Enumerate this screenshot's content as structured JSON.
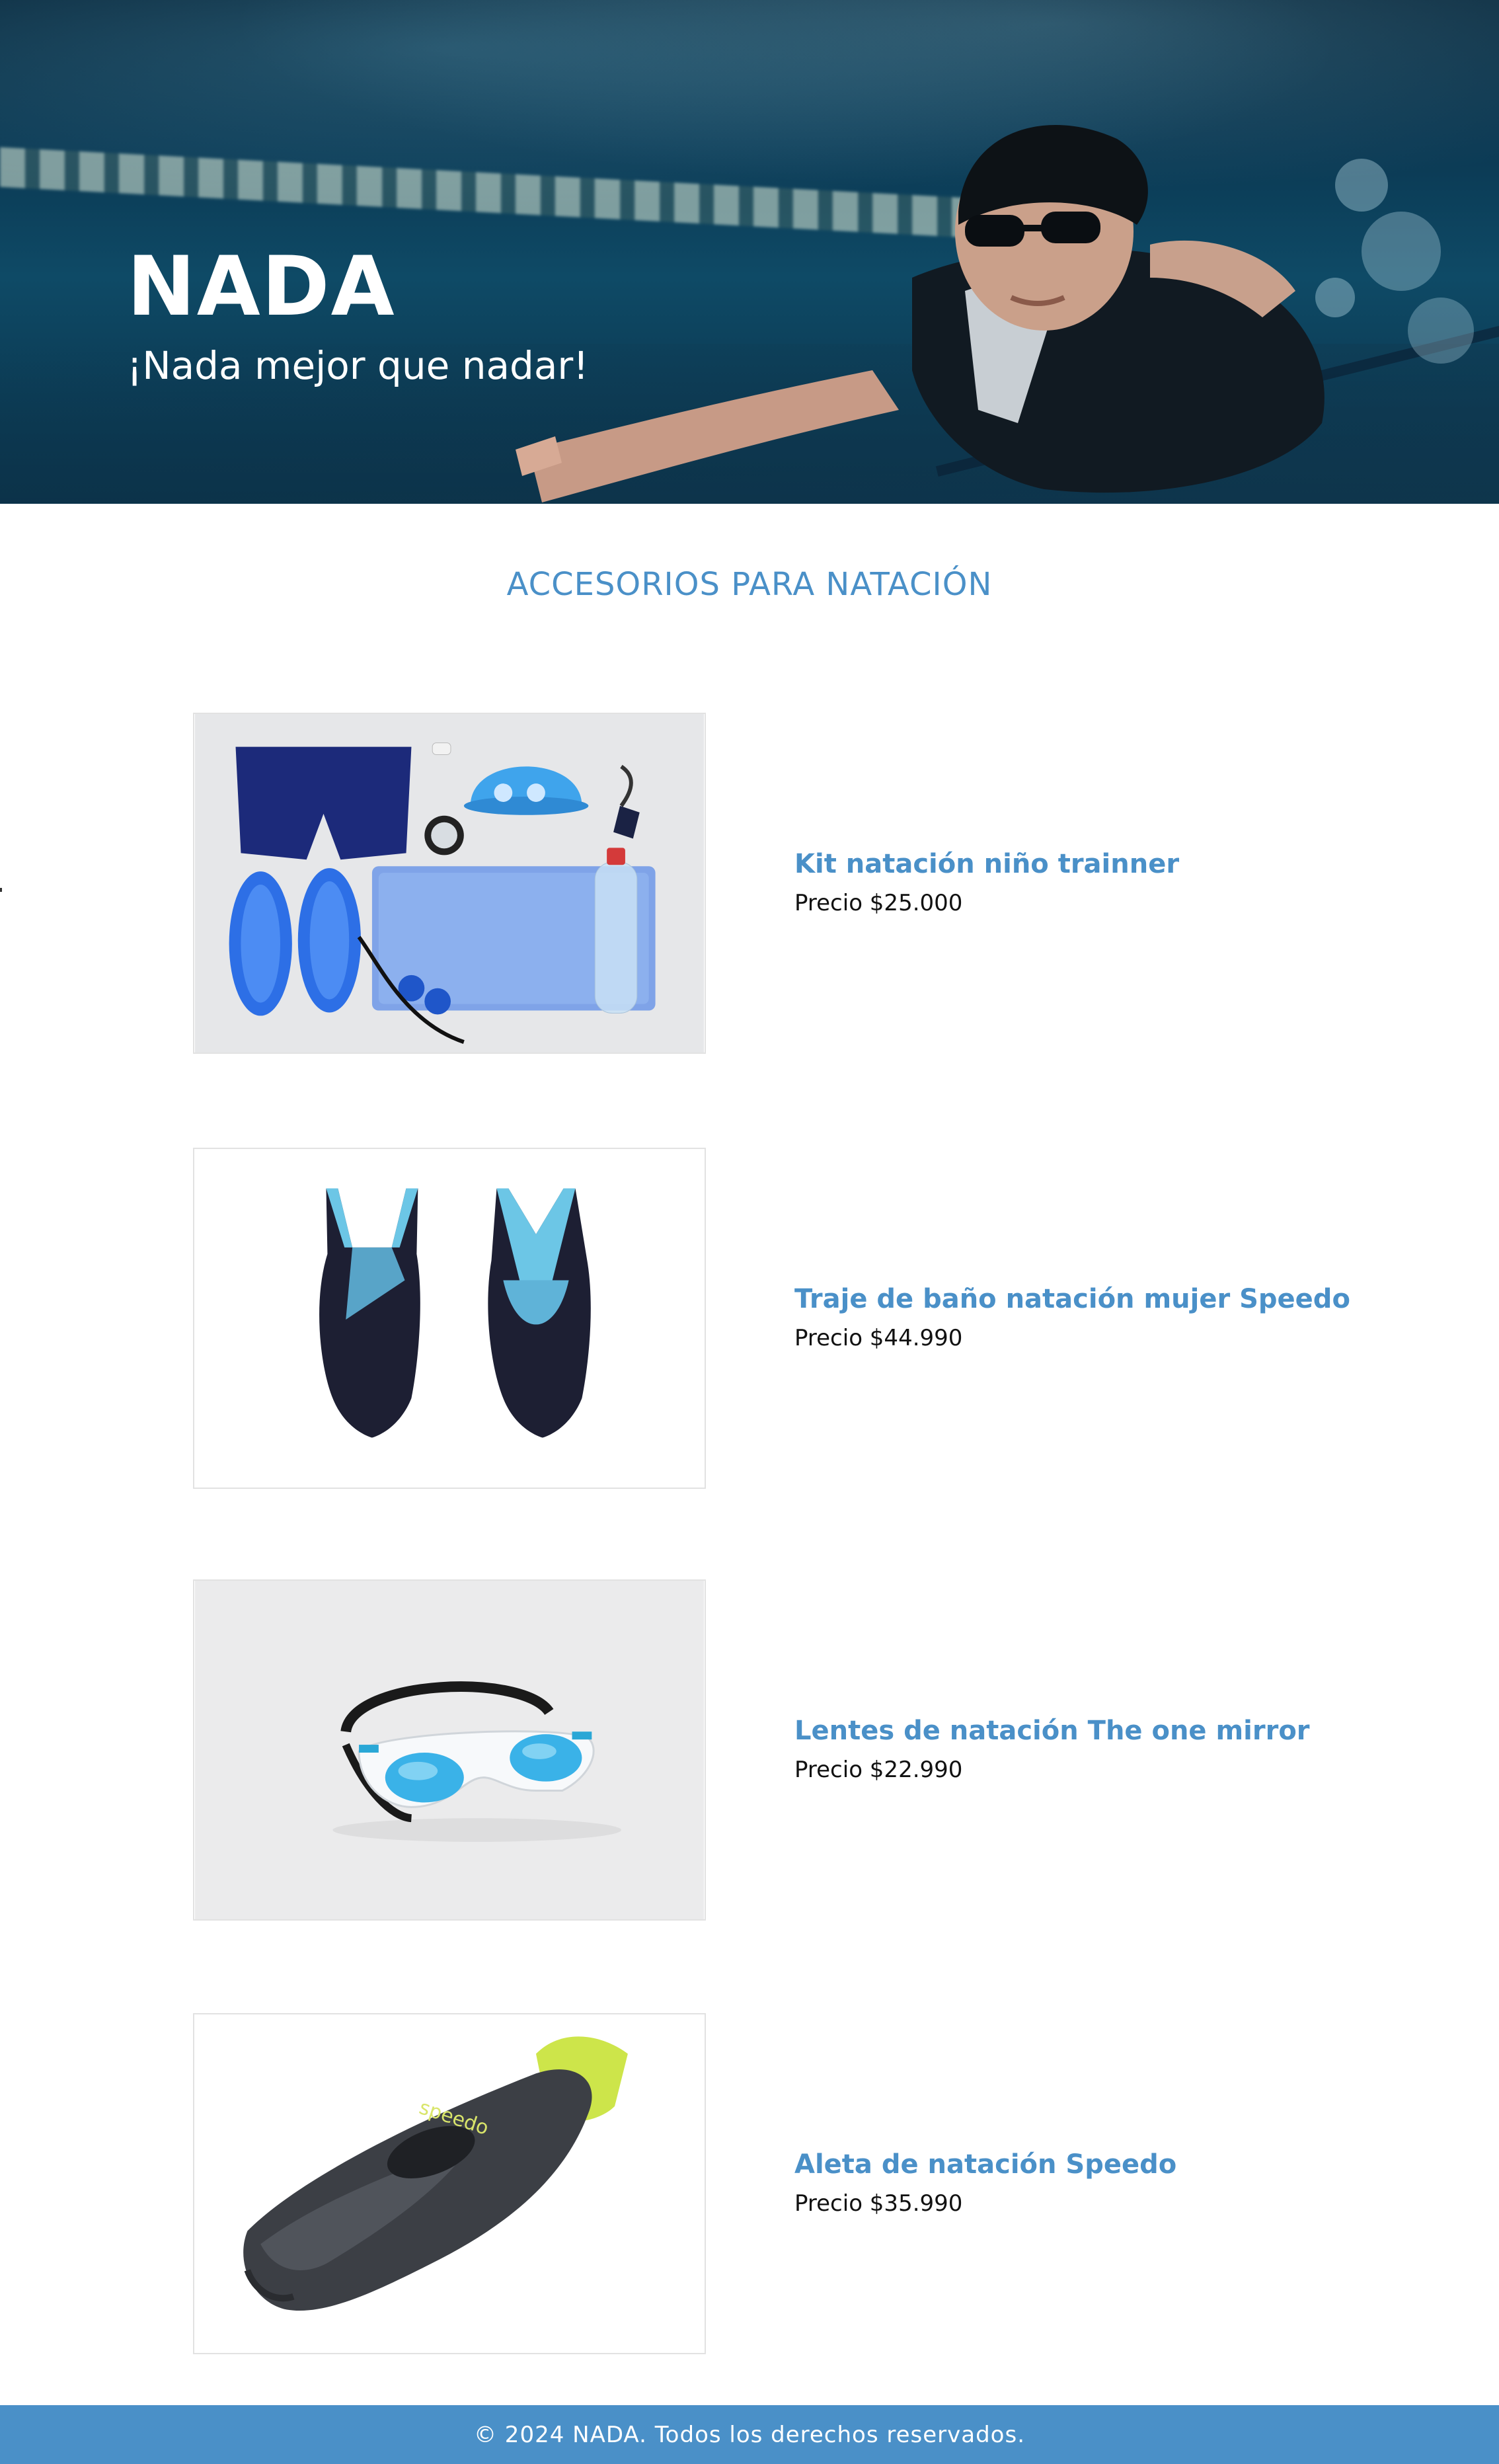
{
  "hero": {
    "brand": "NADA",
    "tagline": "¡Nada mejor que nadar!"
  },
  "section": {
    "title": "ACCESORIOS PARA NATACIÓN"
  },
  "products": [
    {
      "name": "Kit natación niño trainner",
      "price": "Precio $25.000",
      "image_icon": "swim-kit-image"
    },
    {
      "name": "Traje de baño natación mujer Speedo",
      "price": "Precio $44.990",
      "image_icon": "swimsuit-image"
    },
    {
      "name": "Lentes de natación The one mirror",
      "price": "Precio $22.990",
      "image_icon": "goggles-image"
    },
    {
      "name": "Aleta de natación Speedo",
      "price": "Precio $35.990",
      "image_icon": "swim-fin-image"
    }
  ],
  "footer": {
    "text": "© 2024 NADA. Todos los derechos reservados."
  },
  "colors": {
    "accent": "#4a90c8",
    "footer_bg": "#4a90c8",
    "price_text": "#111111"
  }
}
